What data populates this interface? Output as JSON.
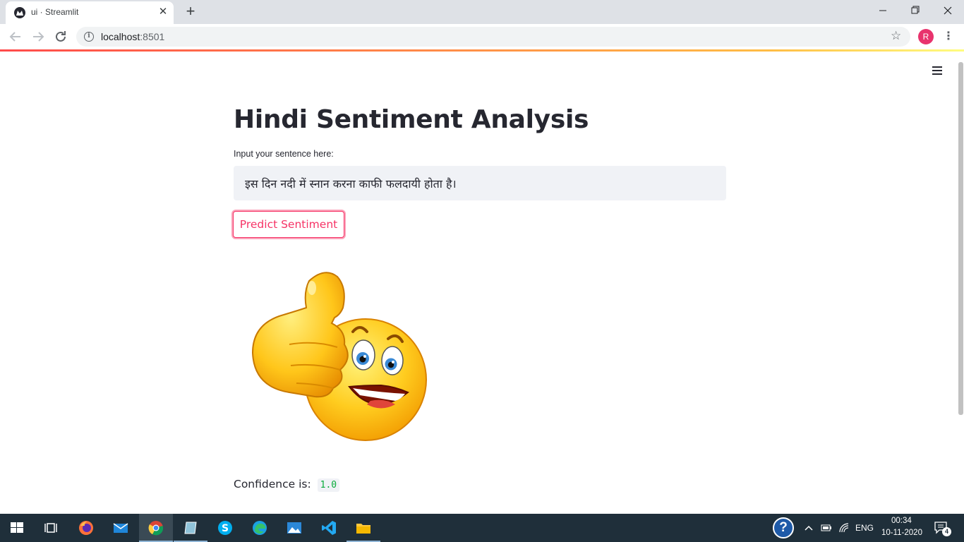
{
  "browser": {
    "tab_title": "ui · Streamlit",
    "tab_close_glyph": "✕",
    "new_tab_glyph": "+",
    "url_host": "localhost",
    "url_port": ":8501",
    "profile_initial": "R"
  },
  "app": {
    "title": "Hindi Sentiment Analysis",
    "input_label": "Input your sentence here:",
    "input_value": "इस दिन नदी में स्नान करना काफी फलदायी होता है।",
    "button_label": "Predict Sentiment",
    "result_icon": "thumbs-up-emoji",
    "confidence_label": "Confidence is:",
    "confidence_value": "1.0",
    "accent_color": "#f63366"
  },
  "taskbar": {
    "language": "ENG",
    "time": "00:34",
    "date": "10-11-2020",
    "notification_count": "4",
    "apps": [
      "start",
      "task-view",
      "firefox",
      "mail",
      "chrome",
      "app-5",
      "skype",
      "edge",
      "photos",
      "vscode",
      "file-explorer"
    ]
  }
}
